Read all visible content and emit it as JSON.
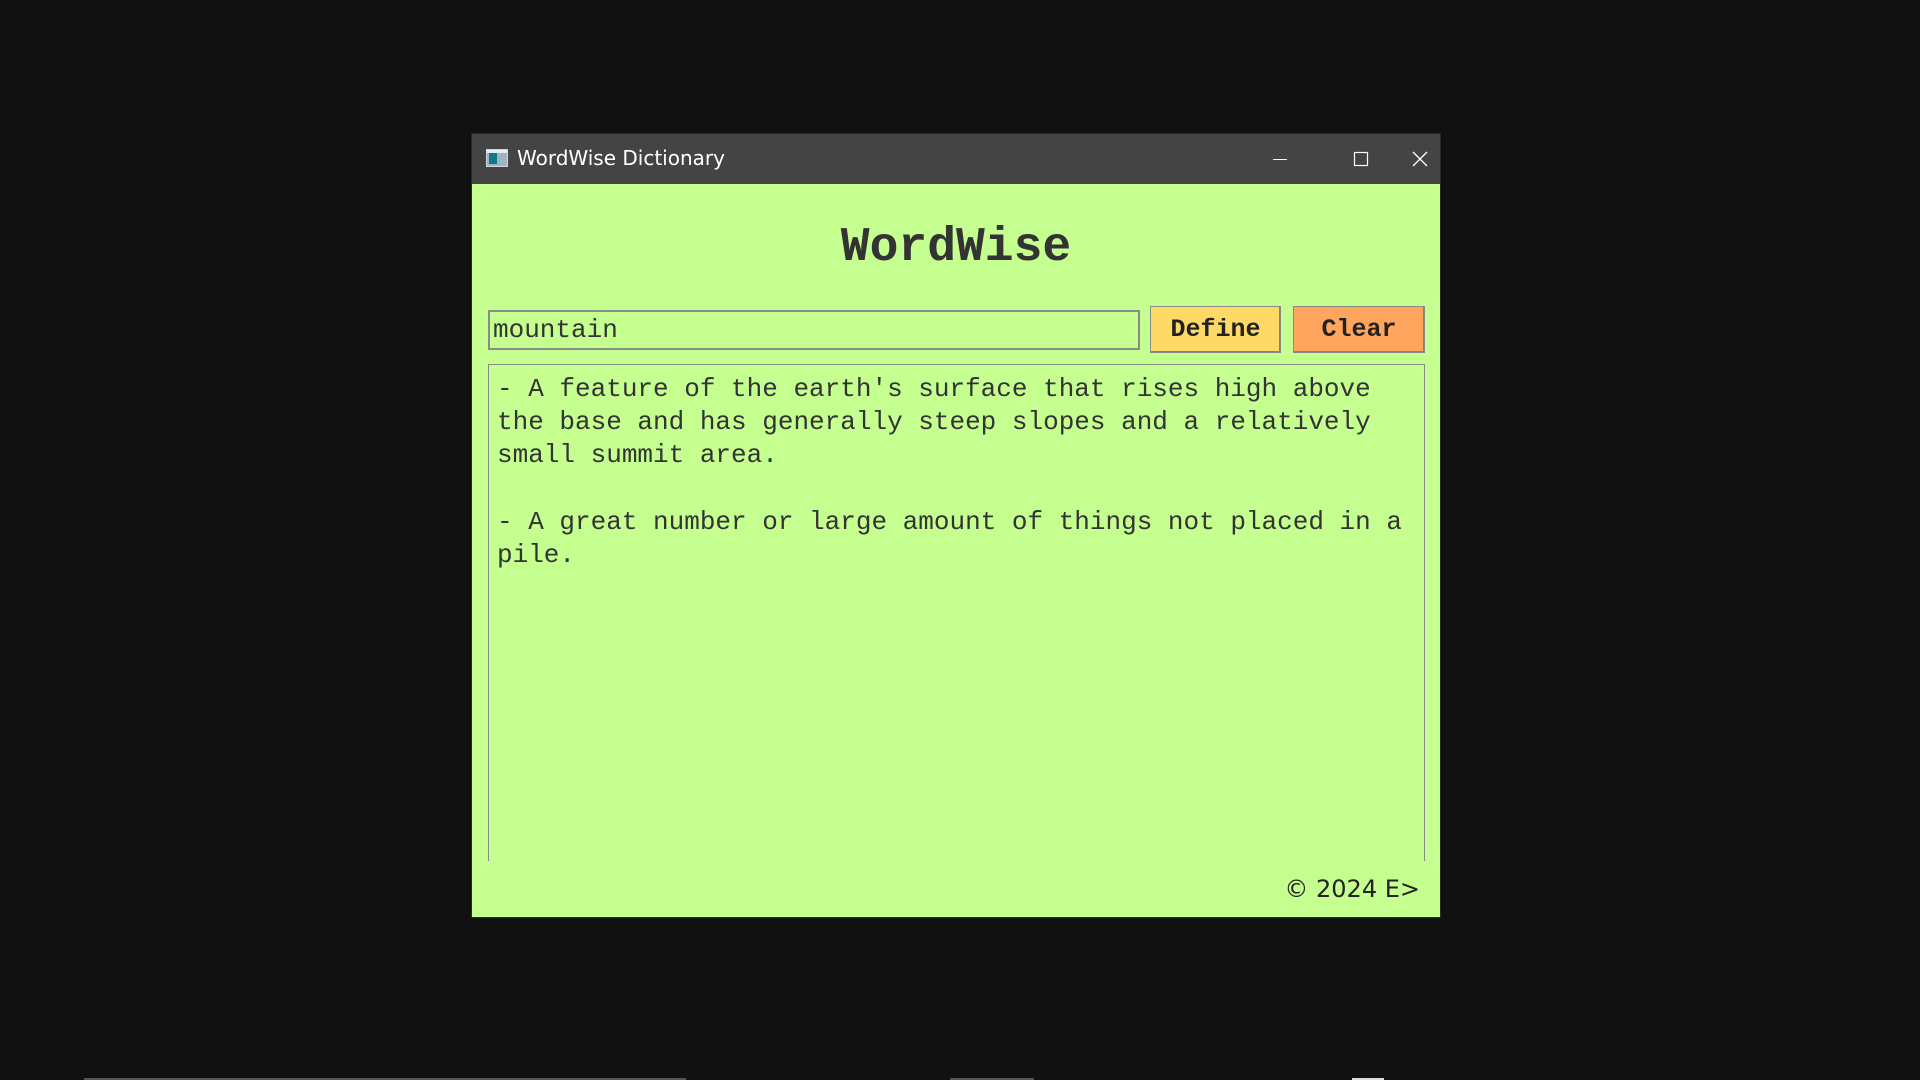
{
  "window": {
    "title": "WordWise Dictionary",
    "icons": {
      "app": "app-window-icon",
      "minimize": "minimize-icon",
      "maximize": "maximize-icon",
      "close": "close-icon"
    }
  },
  "app": {
    "heading": "WordWise",
    "search": {
      "value": "mountain",
      "placeholder": ""
    },
    "buttons": {
      "define_label": "Define",
      "clear_label": "Clear"
    },
    "definitions": [
      "- A feature of the earth's surface that rises high above the base and has generally steep slopes and a relatively small summit area.",
      "- A great number or large amount of things not placed in a pile."
    ],
    "footer": "© 2024 E>"
  },
  "colors": {
    "background": "#c4ff8f",
    "titlebar": "#444444",
    "define_button": "#ffd966",
    "clear_button": "#ffa55e",
    "desktop": "#111111"
  }
}
